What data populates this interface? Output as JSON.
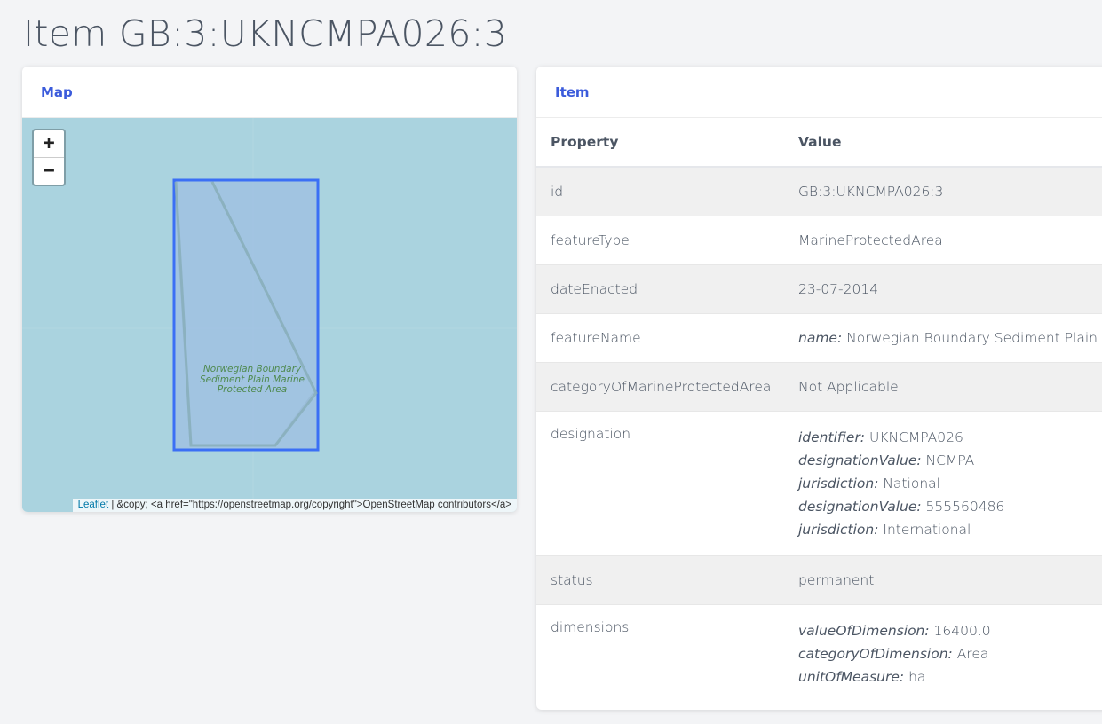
{
  "page_title": "Item GB:3:UKNCMPA026:3",
  "map_card": {
    "title": "Map",
    "zoom_in": "+",
    "zoom_out": "−",
    "feature_label": "Norwegian Boundary Sediment Plain Marine Protected Area",
    "attribution_link": "Leaflet",
    "attribution_rest": " | &copy; <a href=\"https://openstreetmap.org/copyright\">OpenStreetMap contributors</a>"
  },
  "item_card": {
    "title": "Item",
    "columns": [
      "Property",
      "Value"
    ],
    "rows": [
      {
        "property": "id",
        "value": "GB:3:UKNCMPA026:3"
      },
      {
        "property": "featureType",
        "value": "MarineProtectedArea"
      },
      {
        "property": "dateEnacted",
        "value": "23-07-2014"
      },
      {
        "property": "featureName",
        "key": "name:",
        "value": " Norwegian Boundary Sediment Plain"
      },
      {
        "property": "categoryOfMarineProtectedArea",
        "value": "Not Applicable"
      },
      {
        "property": "designation",
        "lines": [
          {
            "key": "identifier:",
            "value": " UKNCMPA026"
          },
          {
            "key": "designationValue:",
            "value": " NCMPA"
          },
          {
            "key": "jurisdiction:",
            "value": " National"
          },
          {
            "key": "designationValue:",
            "value": " 555560486"
          },
          {
            "key": "jurisdiction:",
            "value": " International"
          }
        ]
      },
      {
        "property": "status",
        "value": "permanent"
      },
      {
        "property": "dimensions",
        "lines": [
          {
            "key": "valueOfDimension:",
            "value": " 16400.0"
          },
          {
            "key": "categoryOfDimension:",
            "value": " Area"
          },
          {
            "key": "unitOfMeasure:",
            "value": " ha"
          }
        ]
      }
    ]
  },
  "colors": {
    "accent": "#3b5bdb",
    "sea": "#aad3df",
    "polygon_stroke": "#3b6ff5",
    "polygon_fill": "#9dbfe2"
  }
}
